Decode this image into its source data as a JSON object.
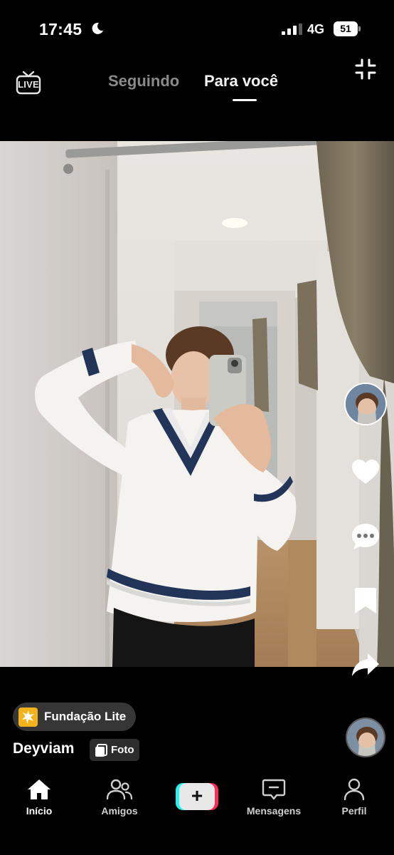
{
  "status_bar": {
    "time": "17:45",
    "network": "4G",
    "battery": "51"
  },
  "top_nav": {
    "live_label": "LIVE",
    "tabs": [
      {
        "label": "Seguindo",
        "active": false
      },
      {
        "label": "Para você",
        "active": true
      }
    ]
  },
  "post": {
    "badge_label": "Fundação Lite",
    "username": "Deyviam",
    "media_type_label": "Foto"
  },
  "actions": {
    "icons": [
      "avatar",
      "heart-icon",
      "comment-icon",
      "bookmark-icon",
      "share-icon"
    ]
  },
  "bottom_nav": {
    "items": [
      {
        "label": "Início",
        "icon": "home-icon"
      },
      {
        "label": "Amigos",
        "icon": "friends-icon"
      },
      {
        "label": "",
        "icon": "create-plus-icon"
      },
      {
        "label": "Mensagens",
        "icon": "inbox-icon"
      },
      {
        "label": "Perfil",
        "icon": "profile-icon"
      }
    ]
  },
  "colors": {
    "background": "#000000",
    "tab_active": "#f2f2f2",
    "tab_inactive": "#8a8a8a",
    "create_cyan": "#25f4ee",
    "create_red": "#fe2c55",
    "badge_icon": "#f3b31c"
  }
}
